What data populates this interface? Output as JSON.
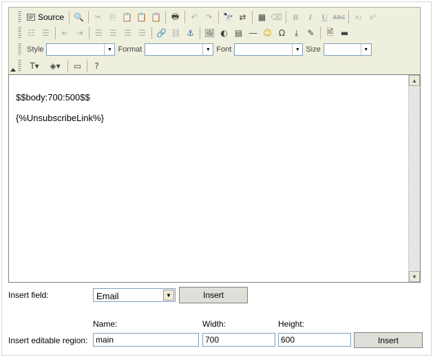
{
  "toolbar": {
    "source_label": "Source",
    "style_label": "Style",
    "format_label": "Format",
    "font_label": "Font",
    "size_label": "Size",
    "style_value": "",
    "format_value": "",
    "font_value": "",
    "size_value": ""
  },
  "editor": {
    "lines": [
      "$$body:700:500$$",
      "{%UnsubscribeLink%}"
    ]
  },
  "insert_field": {
    "label": "Insert field:",
    "selected": "Email",
    "button": "Insert"
  },
  "editable_region": {
    "label": "Insert editable region:",
    "name_label": "Name:",
    "width_label": "Width:",
    "height_label": "Height:",
    "name_value": "main",
    "width_value": "700",
    "height_value": "600",
    "button": "Insert"
  }
}
